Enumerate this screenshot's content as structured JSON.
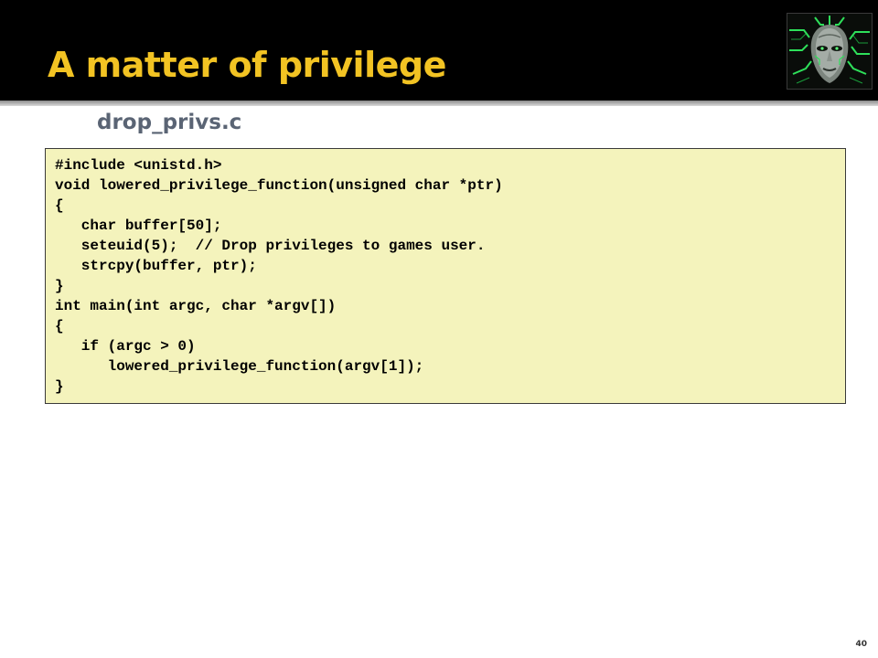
{
  "slide": {
    "title": "A matter of privilege",
    "subtitle": "drop_privs.c",
    "page_number": "40"
  },
  "logo": {
    "icon": "cyber-face-logo-icon"
  },
  "code": {
    "lines": [
      "#include <unistd.h>",
      "void lowered_privilege_function(unsigned char *ptr)",
      "{",
      "   char buffer[50];",
      "   seteuid(5);  // Drop privileges to games user.",
      "   strcpy(buffer, ptr);",
      "}",
      "int main(int argc, char *argv[])",
      "{",
      "   if (argc > 0)",
      "      lowered_privilege_function(argv[1]);",
      "}"
    ]
  },
  "colors": {
    "title": "#f2c323",
    "title_bar": "#000000",
    "subtitle": "#5a6474",
    "code_background": "#f4f3bc"
  }
}
